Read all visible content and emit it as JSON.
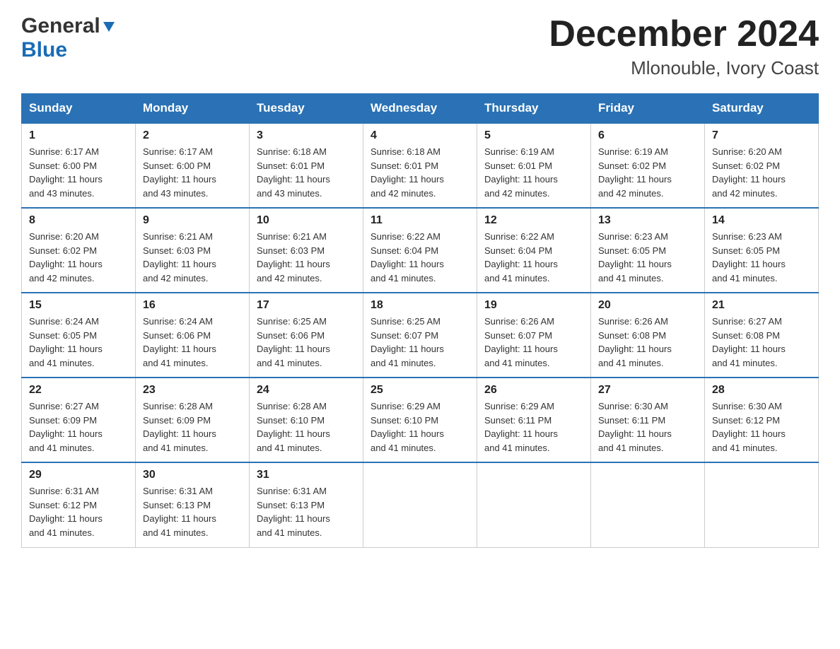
{
  "logo": {
    "general": "General",
    "blue": "Blue"
  },
  "title": {
    "month": "December 2024",
    "location": "Mlonouble, Ivory Coast"
  },
  "days_of_week": [
    "Sunday",
    "Monday",
    "Tuesday",
    "Wednesday",
    "Thursday",
    "Friday",
    "Saturday"
  ],
  "weeks": [
    [
      {
        "day": "1",
        "sunrise": "6:17 AM",
        "sunset": "6:00 PM",
        "daylight": "11 hours and 43 minutes."
      },
      {
        "day": "2",
        "sunrise": "6:17 AM",
        "sunset": "6:00 PM",
        "daylight": "11 hours and 43 minutes."
      },
      {
        "day": "3",
        "sunrise": "6:18 AM",
        "sunset": "6:01 PM",
        "daylight": "11 hours and 43 minutes."
      },
      {
        "day": "4",
        "sunrise": "6:18 AM",
        "sunset": "6:01 PM",
        "daylight": "11 hours and 42 minutes."
      },
      {
        "day": "5",
        "sunrise": "6:19 AM",
        "sunset": "6:01 PM",
        "daylight": "11 hours and 42 minutes."
      },
      {
        "day": "6",
        "sunrise": "6:19 AM",
        "sunset": "6:02 PM",
        "daylight": "11 hours and 42 minutes."
      },
      {
        "day": "7",
        "sunrise": "6:20 AM",
        "sunset": "6:02 PM",
        "daylight": "11 hours and 42 minutes."
      }
    ],
    [
      {
        "day": "8",
        "sunrise": "6:20 AM",
        "sunset": "6:02 PM",
        "daylight": "11 hours and 42 minutes."
      },
      {
        "day": "9",
        "sunrise": "6:21 AM",
        "sunset": "6:03 PM",
        "daylight": "11 hours and 42 minutes."
      },
      {
        "day": "10",
        "sunrise": "6:21 AM",
        "sunset": "6:03 PM",
        "daylight": "11 hours and 42 minutes."
      },
      {
        "day": "11",
        "sunrise": "6:22 AM",
        "sunset": "6:04 PM",
        "daylight": "11 hours and 41 minutes."
      },
      {
        "day": "12",
        "sunrise": "6:22 AM",
        "sunset": "6:04 PM",
        "daylight": "11 hours and 41 minutes."
      },
      {
        "day": "13",
        "sunrise": "6:23 AM",
        "sunset": "6:05 PM",
        "daylight": "11 hours and 41 minutes."
      },
      {
        "day": "14",
        "sunrise": "6:23 AM",
        "sunset": "6:05 PM",
        "daylight": "11 hours and 41 minutes."
      }
    ],
    [
      {
        "day": "15",
        "sunrise": "6:24 AM",
        "sunset": "6:05 PM",
        "daylight": "11 hours and 41 minutes."
      },
      {
        "day": "16",
        "sunrise": "6:24 AM",
        "sunset": "6:06 PM",
        "daylight": "11 hours and 41 minutes."
      },
      {
        "day": "17",
        "sunrise": "6:25 AM",
        "sunset": "6:06 PM",
        "daylight": "11 hours and 41 minutes."
      },
      {
        "day": "18",
        "sunrise": "6:25 AM",
        "sunset": "6:07 PM",
        "daylight": "11 hours and 41 minutes."
      },
      {
        "day": "19",
        "sunrise": "6:26 AM",
        "sunset": "6:07 PM",
        "daylight": "11 hours and 41 minutes."
      },
      {
        "day": "20",
        "sunrise": "6:26 AM",
        "sunset": "6:08 PM",
        "daylight": "11 hours and 41 minutes."
      },
      {
        "day": "21",
        "sunrise": "6:27 AM",
        "sunset": "6:08 PM",
        "daylight": "11 hours and 41 minutes."
      }
    ],
    [
      {
        "day": "22",
        "sunrise": "6:27 AM",
        "sunset": "6:09 PM",
        "daylight": "11 hours and 41 minutes."
      },
      {
        "day": "23",
        "sunrise": "6:28 AM",
        "sunset": "6:09 PM",
        "daylight": "11 hours and 41 minutes."
      },
      {
        "day": "24",
        "sunrise": "6:28 AM",
        "sunset": "6:10 PM",
        "daylight": "11 hours and 41 minutes."
      },
      {
        "day": "25",
        "sunrise": "6:29 AM",
        "sunset": "6:10 PM",
        "daylight": "11 hours and 41 minutes."
      },
      {
        "day": "26",
        "sunrise": "6:29 AM",
        "sunset": "6:11 PM",
        "daylight": "11 hours and 41 minutes."
      },
      {
        "day": "27",
        "sunrise": "6:30 AM",
        "sunset": "6:11 PM",
        "daylight": "11 hours and 41 minutes."
      },
      {
        "day": "28",
        "sunrise": "6:30 AM",
        "sunset": "6:12 PM",
        "daylight": "11 hours and 41 minutes."
      }
    ],
    [
      {
        "day": "29",
        "sunrise": "6:31 AM",
        "sunset": "6:12 PM",
        "daylight": "11 hours and 41 minutes."
      },
      {
        "day": "30",
        "sunrise": "6:31 AM",
        "sunset": "6:13 PM",
        "daylight": "11 hours and 41 minutes."
      },
      {
        "day": "31",
        "sunrise": "6:31 AM",
        "sunset": "6:13 PM",
        "daylight": "11 hours and 41 minutes."
      },
      null,
      null,
      null,
      null
    ]
  ],
  "labels": {
    "sunrise": "Sunrise:",
    "sunset": "Sunset:",
    "daylight": "Daylight:"
  }
}
